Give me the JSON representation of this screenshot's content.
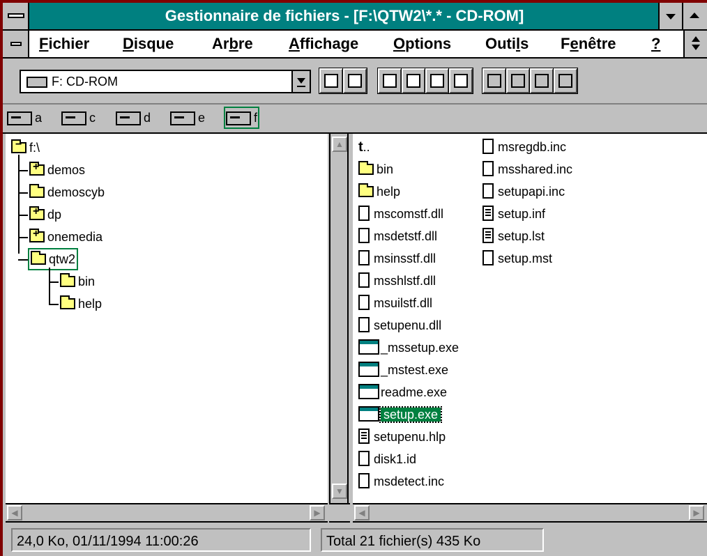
{
  "window": {
    "title": "Gestionnaire de fichiers - [F:\\QTW2\\*.* - CD-ROM]"
  },
  "menu": [
    {
      "label": "Fichier",
      "u": "F",
      "rest": "ichier"
    },
    {
      "label": "Disque",
      "u": "D",
      "rest": "isque"
    },
    {
      "label": "Arbre",
      "pre": "Ar",
      "u": "b",
      "rest": "re"
    },
    {
      "label": "Affichage",
      "u": "A",
      "rest": "ffichage"
    },
    {
      "label": "Options",
      "u": "O",
      "rest": "ptions"
    },
    {
      "label": "Outils",
      "pre": "Outi",
      "u": "l",
      "rest": "s"
    },
    {
      "label": "Fenêtre",
      "pre": "F",
      "u": "e",
      "rest": "nêtre"
    },
    {
      "label": "?",
      "u": "?",
      "rest": ""
    }
  ],
  "toolbar": {
    "drive_select_value": "F: CD-ROM",
    "buttons": [
      "connect-network-drive",
      "disconnect-network-drive",
      "view-name-only",
      "view-all-details",
      "sort-by-name",
      "sort-by-type",
      "new-window",
      "tile-windows",
      "format-disk",
      "copy-disk",
      "properties",
      "run"
    ]
  },
  "drives": [
    {
      "letter": "a",
      "type": "floppy"
    },
    {
      "letter": "c",
      "type": "hard-disk"
    },
    {
      "letter": "d",
      "type": "hard-disk"
    },
    {
      "letter": "e",
      "type": "hard-disk"
    },
    {
      "letter": "f",
      "type": "cd-rom",
      "selected": true
    }
  ],
  "tree": {
    "root": "f:\\",
    "items": [
      {
        "name": "demos",
        "expandable": true
      },
      {
        "name": "demoscyb",
        "expandable": false
      },
      {
        "name": "dp",
        "expandable": true
      },
      {
        "name": "onemedia",
        "expandable": true
      },
      {
        "name": "qtw2",
        "expandable": false,
        "selected": true,
        "open": true
      },
      {
        "name": "bin",
        "expandable": false,
        "child": true
      },
      {
        "name": "help",
        "expandable": false,
        "child": true
      }
    ]
  },
  "files": {
    "col1": [
      {
        "name": "..",
        "type": "up"
      },
      {
        "name": "bin",
        "type": "folder"
      },
      {
        "name": "help",
        "type": "folder"
      },
      {
        "name": "mscomstf.dll",
        "type": "doc"
      },
      {
        "name": "msdetstf.dll",
        "type": "doc"
      },
      {
        "name": "msinsstf.dll",
        "type": "doc"
      },
      {
        "name": "msshlstf.dll",
        "type": "doc"
      },
      {
        "name": "msuilstf.dll",
        "type": "doc"
      },
      {
        "name": "setupenu.dll",
        "type": "doc"
      },
      {
        "name": "_mssetup.exe",
        "type": "exe"
      },
      {
        "name": "_mstest.exe",
        "type": "exe"
      },
      {
        "name": "readme.exe",
        "type": "exe"
      },
      {
        "name": "setup.exe",
        "type": "exe",
        "selected": true
      },
      {
        "name": "setupenu.hlp",
        "type": "text"
      },
      {
        "name": "disk1.id",
        "type": "doc"
      },
      {
        "name": "msdetect.inc",
        "type": "doc"
      }
    ],
    "col2": [
      {
        "name": "msregdb.inc",
        "type": "doc"
      },
      {
        "name": "msshared.inc",
        "type": "doc"
      },
      {
        "name": "setupapi.inc",
        "type": "doc"
      },
      {
        "name": "setup.inf",
        "type": "text"
      },
      {
        "name": "setup.lst",
        "type": "text"
      },
      {
        "name": "setup.mst",
        "type": "doc"
      }
    ]
  },
  "status": {
    "selection": "24,0 Ko, 01/11/1994 11:00:26",
    "total": "Total 21 fichier(s) 435 Ko"
  },
  "colors": {
    "title_bg": "#008080",
    "frame": "#800000",
    "selection": "#008040",
    "folder": "#ffff80"
  }
}
